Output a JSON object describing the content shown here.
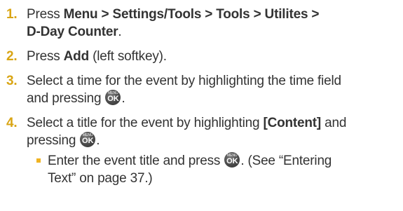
{
  "steps": [
    {
      "number": "1.",
      "prefix": "Press ",
      "bold_path": "Menu > Settings/Tools > Tools > Utilites >",
      "bold_path_line2": "D-Day Counter",
      "suffix": "."
    },
    {
      "number": "2.",
      "prefix": "Press ",
      "bold": "Add",
      "suffix": " (left softkey)."
    },
    {
      "number": "3.",
      "line1": "Select a time for the event by highlighting the time field",
      "line2_before": "and pressing ",
      "line2_after": "."
    },
    {
      "number": "4.",
      "line1_before": "Select a title for the event by highlighting ",
      "bold": "[Content]",
      "line1_after": " and",
      "line2_before": "pressing ",
      "line2_after": "."
    }
  ],
  "substep": {
    "line1_before": "Enter the event title and press ",
    "line1_after": ". (See “Entering",
    "line2": "Text” on page 37.)"
  },
  "ok_button": {
    "top_label": "MENU",
    "main_label": "OK"
  },
  "colors": {
    "number": "#d9a514",
    "bullet": "#f0b323",
    "text": "#333333"
  }
}
